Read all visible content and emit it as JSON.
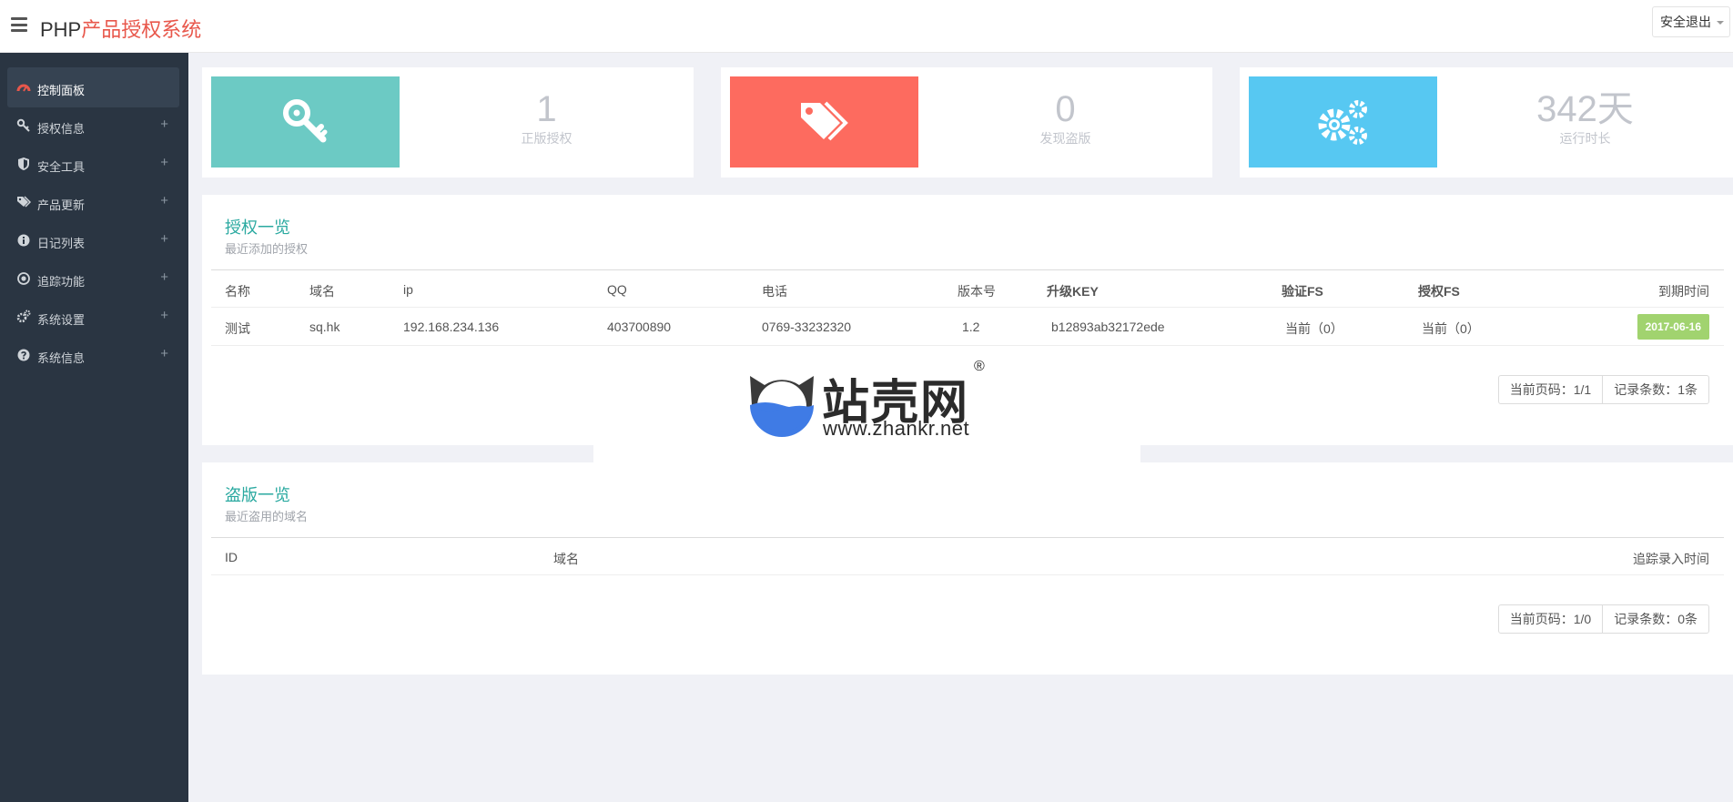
{
  "header": {
    "brand_prefix": "PHP",
    "brand_suffix": "产品授权系统",
    "logout_label": "安全退出"
  },
  "sidebar": {
    "items": [
      {
        "label": "控制面板",
        "icon": "dashboard-icon",
        "active": true
      },
      {
        "label": "授权信息",
        "icon": "key-icon"
      },
      {
        "label": "安全工具",
        "icon": "shield-icon"
      },
      {
        "label": "产品更新",
        "icon": "tags-icon"
      },
      {
        "label": "日记列表",
        "icon": "info-icon"
      },
      {
        "label": "追踪功能",
        "icon": "target-icon"
      },
      {
        "label": "系统设置",
        "icon": "gears-icon"
      },
      {
        "label": "系统信息",
        "icon": "question-icon"
      }
    ],
    "expand_symbol": "+"
  },
  "stats": [
    {
      "value": "1",
      "label": "正版授权",
      "color": "#6ccac4",
      "icon": "key-icon"
    },
    {
      "value": "0",
      "label": "发现盗版",
      "color": "#fd6b5f",
      "icon": "tags-icon"
    },
    {
      "value": "342天",
      "label": "运行时长",
      "color": "#57c8f2",
      "icon": "gears-icon"
    }
  ],
  "licenses": {
    "title": "授权一览",
    "subtitle": "最近添加的授权",
    "columns": [
      "名称",
      "域名",
      "ip",
      "QQ",
      "电话",
      "版本号",
      "升级KEY",
      "验证FS",
      "授权FS",
      "到期时间"
    ],
    "rows": [
      {
        "name": "测试",
        "domain": "sq.hk",
        "ip": "192.168.234.136",
        "qq": "403700890",
        "phone": "0769-33232320",
        "version": "1.2",
        "key": "b12893ab32172ede",
        "verify_fs": "当前（0）",
        "auth_fs": "当前（0）",
        "expire": "2017-06-16"
      }
    ],
    "pager": {
      "page": "当前页码：1/1",
      "count": "记录条数：1条"
    }
  },
  "piracy": {
    "title": "盗版一览",
    "subtitle": "最近盗用的域名",
    "columns": [
      "ID",
      "域名",
      "追踪录入时间"
    ],
    "pager": {
      "page": "当前页码：1/0",
      "count": "记录条数：0条"
    }
  },
  "watermark": {
    "name": "站壳网",
    "reg": "®",
    "url": "www.zhankr.net"
  }
}
